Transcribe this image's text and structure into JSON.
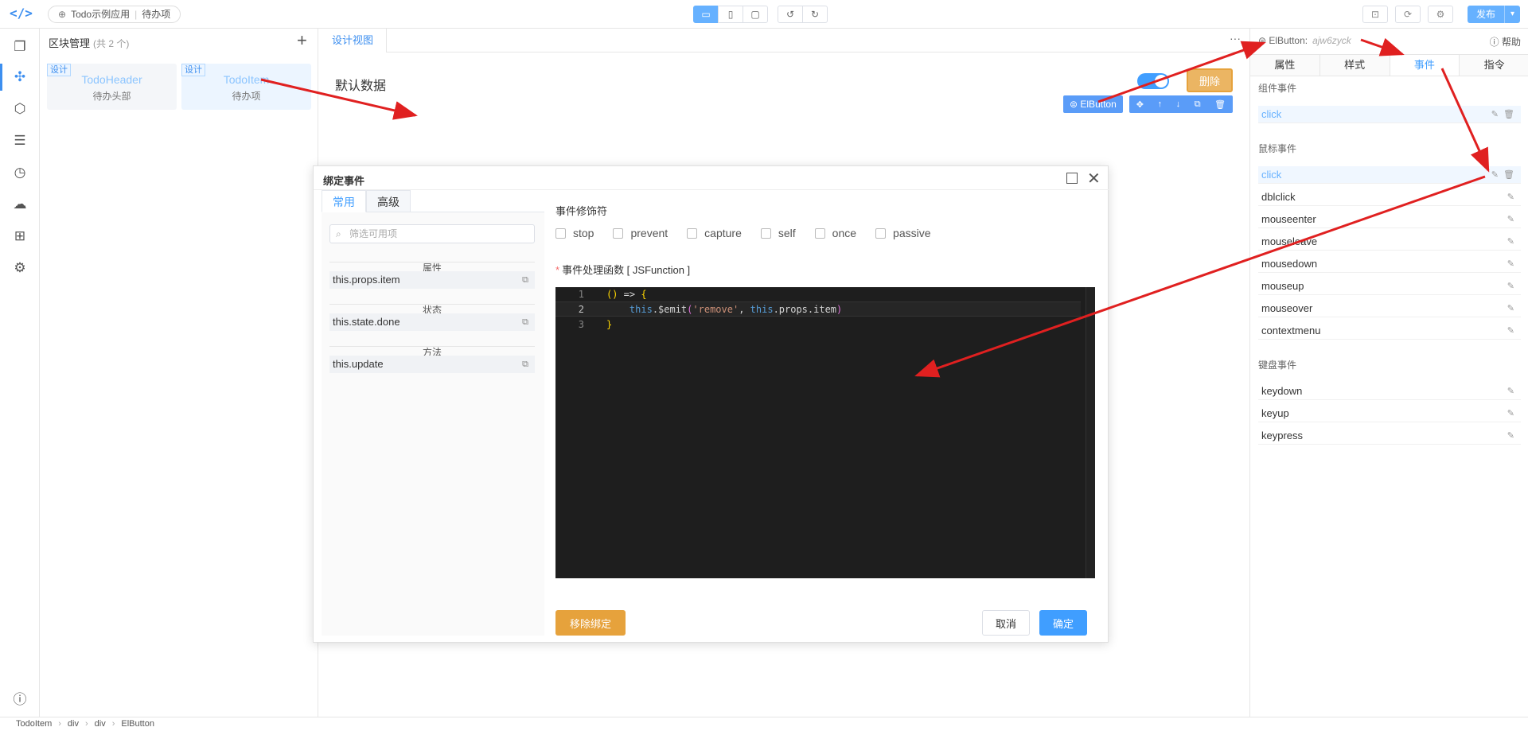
{
  "topbar": {
    "app_name": "Todo示例应用",
    "page_name": "待办项",
    "publish_label": "发布"
  },
  "block_panel": {
    "title": "区块管理",
    "count": "(共 2 个)",
    "blocks": [
      {
        "tag": "设计",
        "name": "TodoHeader",
        "desc": "待办头部"
      },
      {
        "tag": "设计",
        "name": "TodoItem",
        "desc": "待办项"
      }
    ]
  },
  "canvas": {
    "tab_label": "设计视图",
    "default_data_label": "默认数据",
    "delete_button_label": "删除",
    "selected_tag": "ElButton"
  },
  "dialog": {
    "title": "绑定事件",
    "tabs": [
      "常用",
      "高级"
    ],
    "filter_placeholder": "筛选可用项",
    "groups": [
      {
        "label": "属性",
        "items": [
          "this.props.item"
        ]
      },
      {
        "label": "状态",
        "items": [
          "this.state.done"
        ]
      },
      {
        "label": "方法",
        "items": [
          "this.update"
        ]
      }
    ],
    "modifiers_title": "事件修饰符",
    "modifiers": [
      "stop",
      "prevent",
      "capture",
      "self",
      "once",
      "passive"
    ],
    "function_title": "事件处理函数 [ JSFunction ]",
    "code_lines": [
      {
        "num": "1",
        "text": "() => {"
      },
      {
        "num": "2",
        "text": "    this.$emit('remove', this.props.item)"
      },
      {
        "num": "3",
        "text": "}"
      }
    ],
    "remove_binding_label": "移除绑定",
    "cancel_label": "取消",
    "confirm_label": "确定"
  },
  "right_panel": {
    "component_name": "ElButton:",
    "component_id": "ajw6zyck",
    "help_label": "帮助",
    "tabs": [
      "属性",
      "样式",
      "事件",
      "指令"
    ],
    "active_tab": "事件",
    "component_events_title": "组件事件",
    "component_events": [
      "click"
    ],
    "mouse_events_title": "鼠标事件",
    "mouse_events": [
      "click",
      "dblclick",
      "mouseenter",
      "mouseleave",
      "mousedown",
      "mouseup",
      "mouseover",
      "contextmenu"
    ],
    "keyboard_events_title": "键盘事件",
    "keyboard_events": [
      "keydown",
      "keyup",
      "keypress"
    ]
  },
  "statusbar": {
    "path": [
      "TodoItem",
      "div",
      "div",
      "ElButton"
    ]
  },
  "colors": {
    "accent": "#409eff",
    "warning": "#e6a23c",
    "annotation_arrow": "#e02020",
    "editor_bg": "#1e1e1e"
  }
}
